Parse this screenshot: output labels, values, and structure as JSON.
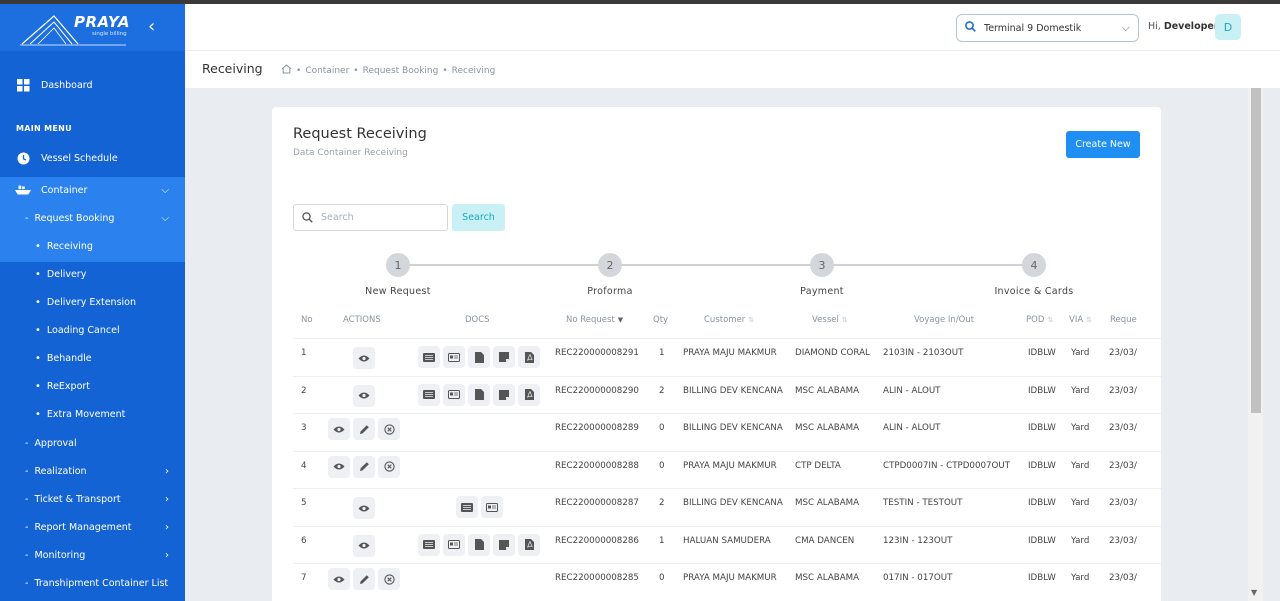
{
  "brand": {
    "name": "PRAYA",
    "tagline": "single billing"
  },
  "sidebar": {
    "dashboard": "Dashboard",
    "main_menu": "MAIN MENU",
    "vessel_schedule": "Vessel Schedule",
    "container": "Container",
    "request_booking": "Request Booking",
    "items": [
      {
        "label": "Receiving",
        "active": true
      },
      {
        "label": "Delivery"
      },
      {
        "label": "Delivery Extension"
      },
      {
        "label": "Loading Cancel"
      },
      {
        "label": "Behandle"
      },
      {
        "label": "ReExport"
      },
      {
        "label": "Extra Movement"
      }
    ],
    "sections": [
      {
        "label": "Approval",
        "has_chevron": false
      },
      {
        "label": "Realization",
        "has_chevron": true
      },
      {
        "label": "Ticket & Transport",
        "has_chevron": true
      },
      {
        "label": "Report Management",
        "has_chevron": true
      },
      {
        "label": "Monitoring",
        "has_chevron": true
      },
      {
        "label": "Transhipment Container List",
        "has_chevron": false
      }
    ]
  },
  "topbar": {
    "terminal": "Terminal 9 Domestik",
    "greeting": "Hi,",
    "user": "Developer",
    "avatar_letter": "D"
  },
  "breadcrumb": {
    "title": "Receiving",
    "items": [
      "Container",
      "Request Booking",
      "Receiving"
    ]
  },
  "card": {
    "title": "Request Receiving",
    "subtitle": "Data Container Receiving",
    "create_button": "Create New",
    "search_placeholder": "Search",
    "search_button": "Search"
  },
  "steps": [
    {
      "num": "1",
      "label": "New Request"
    },
    {
      "num": "2",
      "label": "Proforma"
    },
    {
      "num": "3",
      "label": "Payment"
    },
    {
      "num": "4",
      "label": "Invoice & Cards"
    }
  ],
  "table": {
    "headers": [
      "No",
      "ACTIONS",
      "DOCS",
      "No Request",
      "Qty",
      "Customer",
      "Vessel",
      "Voyage In/Out",
      "POD",
      "VIA",
      "Reque"
    ],
    "rows": [
      {
        "no": "1",
        "actions": [
          "view"
        ],
        "docs": [
          "list",
          "card",
          "file",
          "note",
          "pdf"
        ],
        "request": "REC220000008291",
        "qty": "1",
        "customer": "PRAYA MAJU MAKMUR",
        "vessel": "DIAMOND CORAL",
        "voyage": "2103IN - 2103OUT",
        "pod": "IDBLW",
        "via": "Yard",
        "date": "23/03/"
      },
      {
        "no": "2",
        "actions": [
          "view"
        ],
        "docs": [
          "list",
          "card",
          "file",
          "note",
          "pdf"
        ],
        "request": "REC220000008290",
        "qty": "2",
        "customer": "BILLING DEV KENCANA",
        "vessel": "MSC ALABAMA",
        "voyage": "ALIN - ALOUT",
        "pod": "IDBLW",
        "via": "Yard",
        "date": "23/03/"
      },
      {
        "no": "3",
        "actions": [
          "view",
          "edit",
          "cancel"
        ],
        "docs": [],
        "request": "REC220000008289",
        "qty": "0",
        "customer": "BILLING DEV KENCANA",
        "vessel": "MSC ALABAMA",
        "voyage": "ALIN - ALOUT",
        "pod": "IDBLW",
        "via": "Yard",
        "date": "23/03/"
      },
      {
        "no": "4",
        "actions": [
          "view",
          "edit",
          "cancel"
        ],
        "docs": [],
        "request": "REC220000008288",
        "qty": "0",
        "customer": "PRAYA MAJU MAKMUR",
        "vessel": "CTP DELTA",
        "voyage": "CTPD0007IN - CTPD0007OUT",
        "pod": "IDBLW",
        "via": "Yard",
        "date": "23/03/"
      },
      {
        "no": "5",
        "actions": [
          "view"
        ],
        "docs": [
          "list",
          "card"
        ],
        "request": "REC220000008287",
        "qty": "2",
        "customer": "BILLING DEV KENCANA",
        "vessel": "MSC ALABAMA",
        "voyage": "TESTIN - TESTOUT",
        "pod": "IDBLW",
        "via": "Yard",
        "date": "23/03/"
      },
      {
        "no": "6",
        "actions": [
          "view"
        ],
        "docs": [
          "list",
          "card",
          "file",
          "note",
          "pdf"
        ],
        "request": "REC220000008286",
        "qty": "1",
        "customer": "HALUAN SAMUDERA",
        "vessel": "CMA DANCEN",
        "voyage": "123IN - 123OUT",
        "pod": "IDBLW",
        "via": "Yard",
        "date": "23/03/"
      },
      {
        "no": "7",
        "actions": [
          "view",
          "edit",
          "cancel"
        ],
        "docs": [],
        "request": "REC220000008285",
        "qty": "0",
        "customer": "PRAYA MAJU MAKMUR",
        "vessel": "MSC ALABAMA",
        "voyage": "017IN - 017OUT",
        "pod": "IDBLW",
        "via": "Yard",
        "date": "23/03/"
      }
    ]
  },
  "colors": {
    "sidebar": "#1463d4",
    "sidebar_active": "#2b82ef",
    "primary_button": "#1f8ff3",
    "search_button_bg": "#c9f0f5"
  }
}
